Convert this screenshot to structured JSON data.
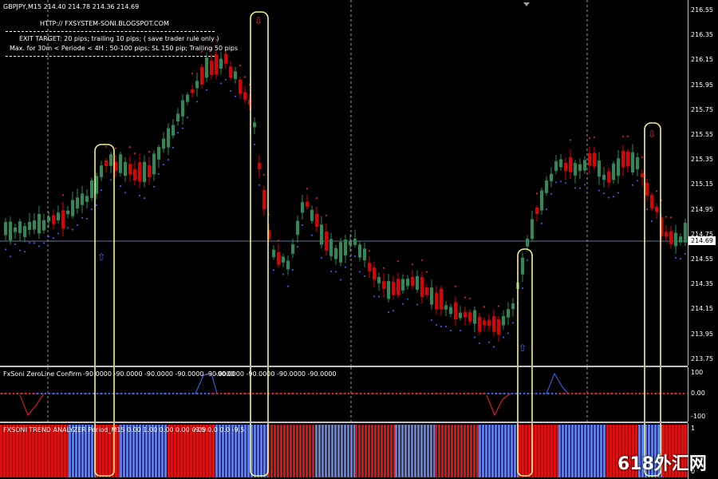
{
  "header": {
    "symbol_line": "GBPJPY,M15  214.40 214.78 214.36 214.69",
    "site": "HTTP:// FXSYSTEM-SONI.BLOGSPOT.COM",
    "note1": "EXIT TARGET: 20 pips; trailing 10 pips; ( save trader rule only )",
    "note2": "Max. for 30m  < Periode  < 4H : 50-100 pips; SL 150 pip; Trailing 50 pips"
  },
  "price_axis": [
    "216.55",
    "216.35",
    "216.15",
    "215.95",
    "215.75",
    "215.55",
    "215.35",
    "215.15",
    "214.95",
    "214.75",
    "214.55",
    "214.35",
    "214.15",
    "213.95",
    "213.75"
  ],
  "current_price": "214.69",
  "zeroline": {
    "label": "FxSoni ZeroLine Confirm",
    "values": "-90.0000 -90.0000 -90.0000 -90.0000 -90.0000",
    "values2": "-90.0000 -90.0000 -90.0000 -90.0000",
    "axis": [
      "100",
      "0.00",
      "-100"
    ]
  },
  "trend": {
    "label": "FXSONI TREND ANALYZER Period_M15 0.00 1.00 0.00 0.00 0.00",
    "values": "-9.5 0.0 0.0 -9.5",
    "axis": [
      "1",
      "0"
    ]
  },
  "watermark": "618外汇网",
  "colors": {
    "bull": "#2e8b57",
    "bear": "#e00000",
    "dot_up": "#3a6bff",
    "dot_down": "#ff2020",
    "highlight": "#f4f48a",
    "grid": "#ffffff",
    "bar_blue": "#5a7fe0",
    "bar_red": "#e01010"
  }
}
